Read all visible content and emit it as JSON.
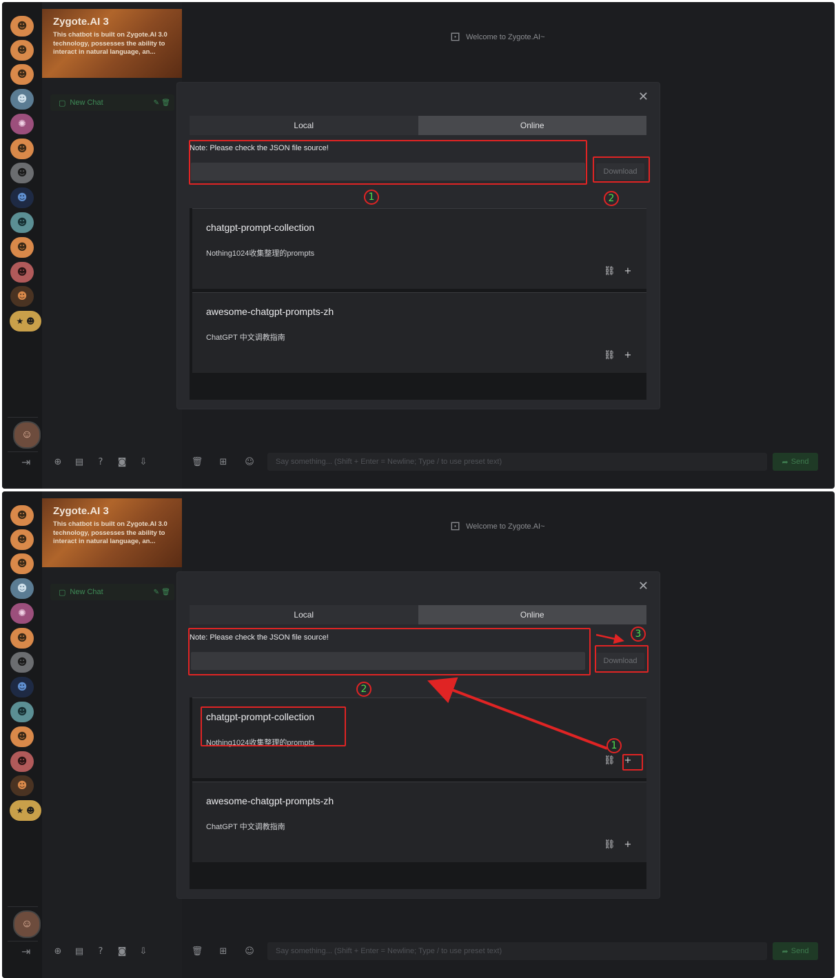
{
  "app": {
    "banner_title": "Zygote.AI 3",
    "banner_desc": "This chatbot is built on Zygote.AI 3.0 technology, possesses the ability to interact in natural language, an...",
    "welcome": "Welcome to Zygote.AI~",
    "new_chat": "New Chat",
    "input_placeholder": "Say something... (Shift + Enter = Newline; Type / to use preset text)",
    "send_label": "Send"
  },
  "modal": {
    "tabs": [
      "Local",
      "Online"
    ],
    "note": "Note: Please check the JSON file source!",
    "url_value": "",
    "download_label": "Download",
    "items": [
      {
        "title": "chatgpt-prompt-collection",
        "desc": "Nothing1024收集整理的prompts"
      },
      {
        "title": "awesome-chatgpt-prompts-zh",
        "desc": "ChatGPT 中文调教指南"
      }
    ]
  },
  "annotations": {
    "panel1": [
      "1",
      "2"
    ],
    "panel2": [
      "1",
      "2",
      "3"
    ],
    "color": "#e02424",
    "number_color": "#4ee04e"
  },
  "icons": [
    "robot-icon",
    "close-icon",
    "link-icon",
    "plus-icon",
    "trash-icon",
    "edit-icon",
    "chat-icon",
    "send-icon",
    "logout-icon",
    "add-icon",
    "document-icon",
    "help-icon",
    "camera-icon",
    "download-icon"
  ],
  "colors": {
    "background": "#1c1d20",
    "accent": "#3e8a56",
    "highlight": "#e02424"
  }
}
